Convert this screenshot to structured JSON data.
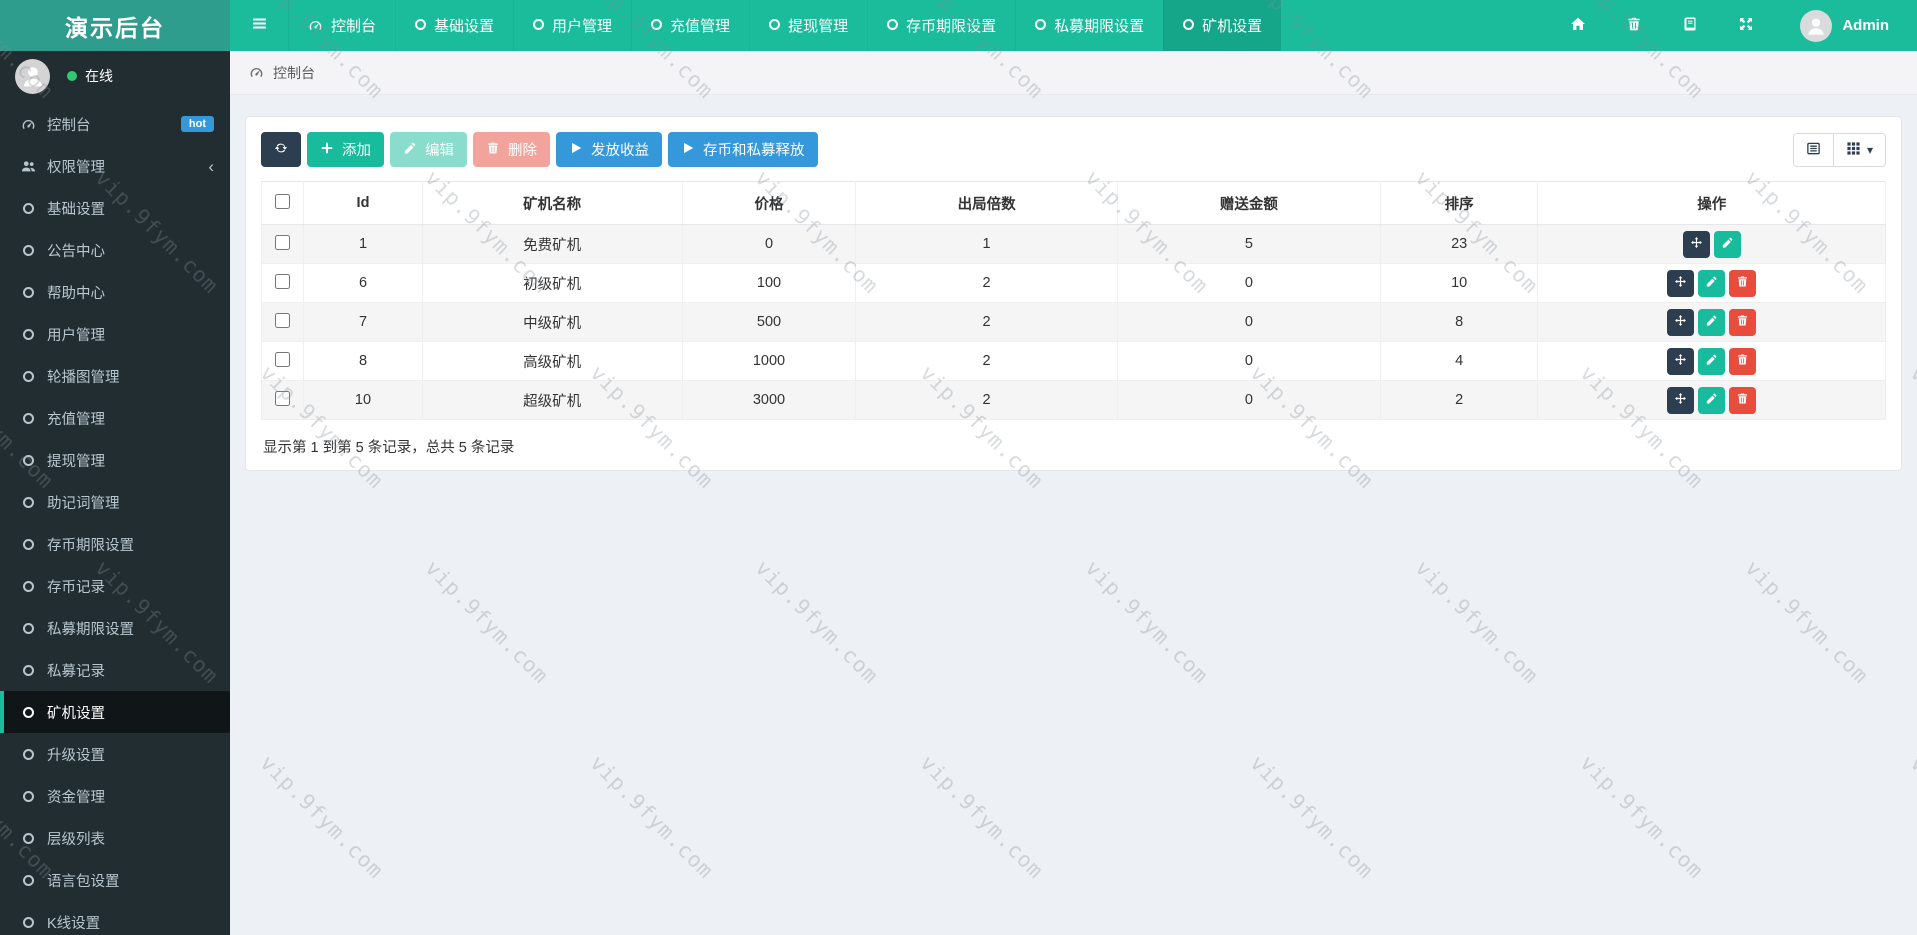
{
  "app": {
    "brand": "演示后台"
  },
  "topnav": {
    "items": [
      {
        "label": "控制台",
        "icon": "dashboard-icon",
        "active": false
      },
      {
        "label": "基础设置",
        "icon": "circle-icon",
        "active": false
      },
      {
        "label": "用户管理",
        "icon": "circle-icon",
        "active": false
      },
      {
        "label": "充值管理",
        "icon": "circle-icon",
        "active": false
      },
      {
        "label": "提现管理",
        "icon": "circle-icon",
        "active": false
      },
      {
        "label": "存币期限设置",
        "icon": "circle-icon",
        "active": false
      },
      {
        "label": "私募期限设置",
        "icon": "circle-icon",
        "active": false
      },
      {
        "label": "矿机设置",
        "icon": "circle-icon",
        "active": true
      }
    ],
    "right_icons": [
      "home-icon",
      "trash-icon",
      "log-icon",
      "fullscreen-icon"
    ],
    "user": "Admin"
  },
  "sidebar": {
    "online_label": "在线",
    "items": [
      {
        "label": "控制台",
        "icon": "dashboard-icon",
        "badge": "hot"
      },
      {
        "label": "权限管理",
        "icon": "users-icon",
        "chevron": "‹"
      },
      {
        "label": "基础设置",
        "icon": "circle-icon"
      },
      {
        "label": "公告中心",
        "icon": "circle-icon"
      },
      {
        "label": "帮助中心",
        "icon": "circle-icon"
      },
      {
        "label": "用户管理",
        "icon": "circle-icon"
      },
      {
        "label": "轮播图管理",
        "icon": "circle-icon"
      },
      {
        "label": "充值管理",
        "icon": "circle-icon"
      },
      {
        "label": "提现管理",
        "icon": "circle-icon"
      },
      {
        "label": "助记词管理",
        "icon": "circle-icon"
      },
      {
        "label": "存币期限设置",
        "icon": "circle-icon"
      },
      {
        "label": "存币记录",
        "icon": "circle-icon"
      },
      {
        "label": "私募期限设置",
        "icon": "circle-icon"
      },
      {
        "label": "私募记录",
        "icon": "circle-icon"
      },
      {
        "label": "矿机设置",
        "icon": "circle-icon",
        "active": true
      },
      {
        "label": "升级设置",
        "icon": "circle-icon"
      },
      {
        "label": "资金管理",
        "icon": "circle-icon"
      },
      {
        "label": "层级列表",
        "icon": "circle-icon"
      },
      {
        "label": "语言包设置",
        "icon": "circle-icon"
      },
      {
        "label": "K线设置",
        "icon": "circle-icon"
      }
    ]
  },
  "breadcrumb": {
    "label": "控制台"
  },
  "toolbar": {
    "buttons": [
      {
        "name": "refresh",
        "icon": "refresh-icon",
        "label": "",
        "style": "dark",
        "disabled": false
      },
      {
        "name": "add",
        "icon": "plus-icon",
        "label": "添加",
        "style": "green",
        "disabled": false
      },
      {
        "name": "edit",
        "icon": "pencil-icon",
        "label": "编辑",
        "style": "green",
        "disabled": true
      },
      {
        "name": "delete",
        "icon": "trash-icon",
        "label": "删除",
        "style": "red",
        "disabled": true
      },
      {
        "name": "grant-earnings",
        "icon": "play-icon",
        "label": "发放收益",
        "style": "blue",
        "disabled": false
      },
      {
        "name": "deposit-release",
        "icon": "play-icon",
        "label": "存币和私募释放",
        "style": "blue",
        "disabled": false
      }
    ],
    "view_buttons": [
      "list-view-icon",
      "grid-view-icon"
    ]
  },
  "table": {
    "columns": [
      "Id",
      "矿机名称",
      "价格",
      "出局倍数",
      "赠送金额",
      "排序",
      "操作"
    ],
    "rows": [
      {
        "id": "1",
        "name": "免费矿机",
        "price": "0",
        "multiple": "1",
        "bonus": "5",
        "sort": "23",
        "actions": [
          "move",
          "edit"
        ]
      },
      {
        "id": "6",
        "name": "初级矿机",
        "price": "100",
        "multiple": "2",
        "bonus": "0",
        "sort": "10",
        "actions": [
          "move",
          "edit",
          "delete"
        ]
      },
      {
        "id": "7",
        "name": "中级矿机",
        "price": "500",
        "multiple": "2",
        "bonus": "0",
        "sort": "8",
        "actions": [
          "move",
          "edit",
          "delete"
        ]
      },
      {
        "id": "8",
        "name": "高级矿机",
        "price": "1000",
        "multiple": "2",
        "bonus": "0",
        "sort": "4",
        "actions": [
          "move",
          "edit",
          "delete"
        ]
      },
      {
        "id": "10",
        "name": "超级矿机",
        "price": "3000",
        "multiple": "2",
        "bonus": "0",
        "sort": "2",
        "actions": [
          "move",
          "edit",
          "delete"
        ]
      }
    ],
    "summary": "显示第 1 到第 5 条记录，总共 5 条记录"
  },
  "watermark": {
    "text": "vip.9fym.com"
  },
  "colors": {
    "navbar": "#1abc9c",
    "sidebar": "#222d32",
    "success": "#18bc9c",
    "info": "#3498db",
    "danger": "#e74c3c",
    "primary": "#2c3e50"
  }
}
